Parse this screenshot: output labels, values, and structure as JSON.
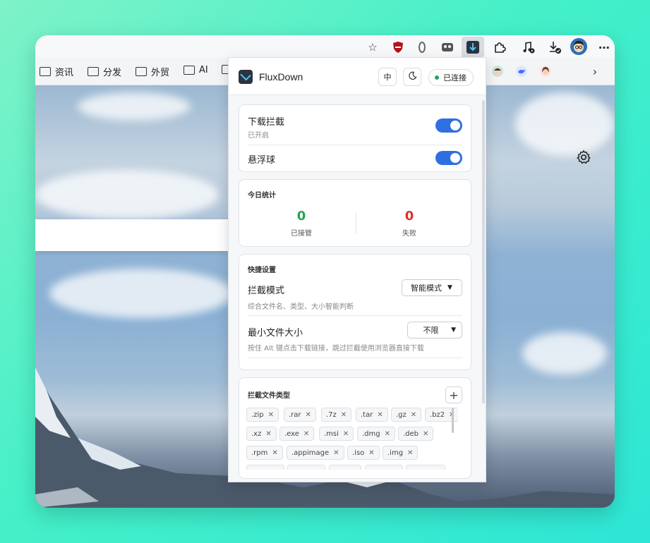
{
  "extension_bar": {
    "icons": [
      "star-icon",
      "ublock-shield-icon",
      "zero-extension-icon",
      "mask-extension-icon",
      "fluxdown-extension-icon",
      "puzzle-icon",
      "media-control-icon",
      "download-icon",
      "profile-avatar-icon",
      "more-menu-icon"
    ]
  },
  "bookmarks": [
    {
      "label": "资讯"
    },
    {
      "label": "分发"
    },
    {
      "label": "外贸"
    },
    {
      "label": "AI"
    }
  ],
  "popup": {
    "title": "FluxDown",
    "lang_button": "中",
    "status": "已连接",
    "intercept": {
      "label": "下载拦截",
      "sub": "已开启",
      "enabled": true
    },
    "float_ball": {
      "label": "悬浮球",
      "enabled": true
    },
    "stats": {
      "title": "今日统计",
      "taken_value": "0",
      "taken_label": "已接管",
      "taken_color": "#22a55a",
      "failed_value": "0",
      "failed_label": "失败",
      "failed_color": "#d9342b"
    },
    "quick": {
      "title": "快捷设置",
      "mode_label": "拦截模式",
      "mode_value": "智能模式",
      "mode_hint": "综合文件名、类型、大小智能判断",
      "size_label": "最小文件大小",
      "size_value": "不限",
      "size_hint": "按住 Alt 键点击下载链接，跳过拦截使用浏览器直接下载"
    },
    "filetypes": {
      "title": "拦截文件类型",
      "add": "+",
      "tags": [
        ".zip",
        ".rar",
        ".7z",
        ".tar",
        ".gz",
        ".bz2",
        ".xz",
        ".exe",
        ".msi",
        ".dmg",
        ".deb",
        ".rpm",
        ".appimage",
        ".iso",
        ".img"
      ]
    }
  }
}
